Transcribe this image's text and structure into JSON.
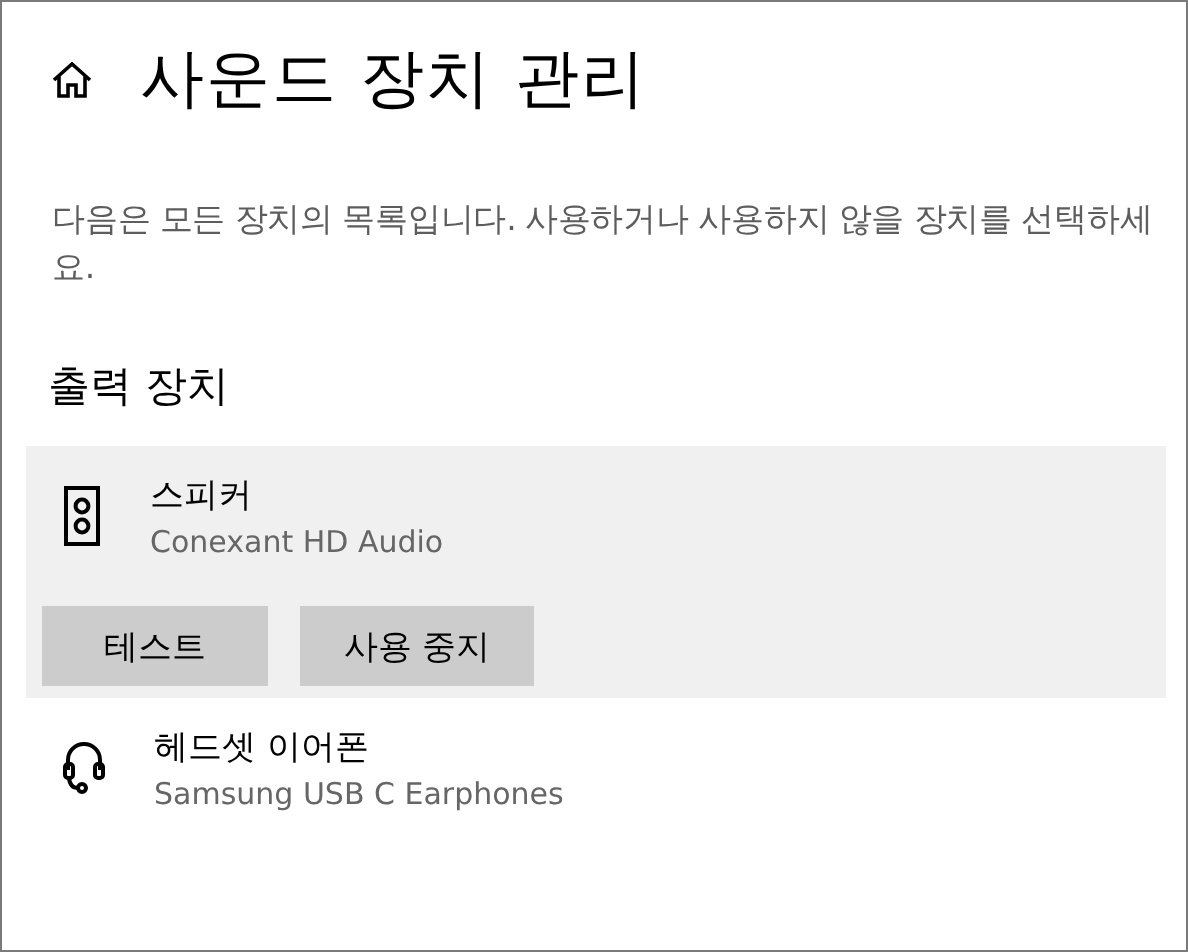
{
  "page": {
    "title": "사운드 장치 관리",
    "description": "다음은 모든 장치의 목록입니다. 사용하거나 사용하지 않을 장치를 선택하세요."
  },
  "output_section": {
    "heading": "출력 장치",
    "devices": [
      {
        "kind": "speaker",
        "name": "스피커",
        "driver": "Conexant HD Audio",
        "selected": true,
        "buttons": [
          "테스트",
          "사용 중지"
        ]
      },
      {
        "kind": "headset",
        "name": "헤드셋 이어폰",
        "driver": "Samsung USB C Earphones",
        "selected": false
      }
    ]
  }
}
